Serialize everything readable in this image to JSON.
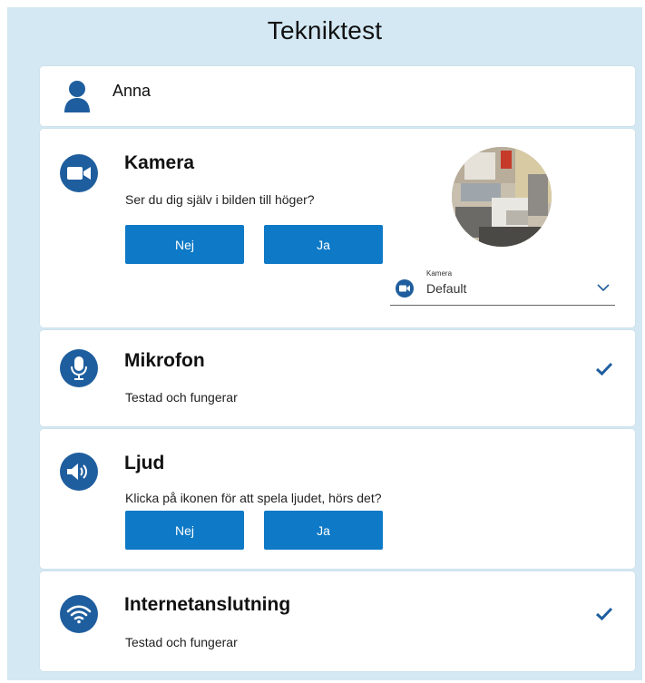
{
  "page": {
    "title": "Tekniktest"
  },
  "user": {
    "name": "Anna"
  },
  "camera": {
    "heading": "Kamera",
    "question": "Ser du dig själv i bilden till höger?",
    "no_label": "Nej",
    "yes_label": "Ja",
    "select_label": "Kamera",
    "select_value": "Default"
  },
  "microphone": {
    "heading": "Mikrofon",
    "status": "Testad och fungerar"
  },
  "sound": {
    "heading": "Ljud",
    "question": "Klicka på ikonen för att spela ljudet, hörs det?",
    "no_label": "Nej",
    "yes_label": "Ja"
  },
  "internet": {
    "heading": "Internetanslutning",
    "status": "Testad och fungerar"
  },
  "colors": {
    "accent": "#0e79c6",
    "icon": "#1f5e9e",
    "background": "#d3e8f3"
  }
}
